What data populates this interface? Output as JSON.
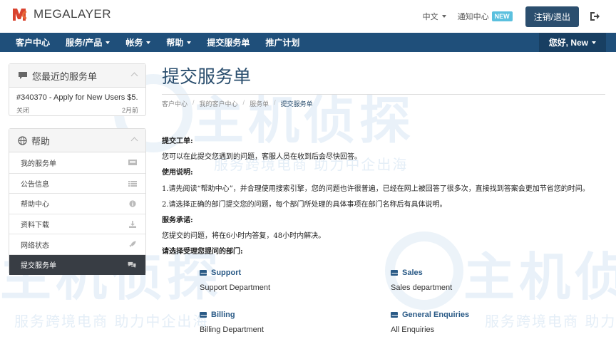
{
  "brand": {
    "logo_text": "MEGALAYER"
  },
  "top": {
    "language": "中文",
    "notifications": "通知中心",
    "new_badge": "NEW",
    "logout": "注销/退出"
  },
  "nav": {
    "items": [
      {
        "label": "客户中心",
        "dropdown": false
      },
      {
        "label": "服务/产品",
        "dropdown": true
      },
      {
        "label": "帐务",
        "dropdown": true
      },
      {
        "label": "帮助",
        "dropdown": true
      },
      {
        "label": "提交服务单",
        "dropdown": false
      },
      {
        "label": "推广计划",
        "dropdown": false
      }
    ],
    "user": "您好, New"
  },
  "recent_panel": {
    "title": "您最近的服务单",
    "ticket": {
      "title": "#340370 - Apply for New Users $5...",
      "status": "关闭",
      "age": "2月前"
    }
  },
  "help_panel": {
    "title": "帮助",
    "items": [
      {
        "label": "我的服务单",
        "icon": "ticket-icon"
      },
      {
        "label": "公告信息",
        "icon": "list-icon"
      },
      {
        "label": "帮助中心",
        "icon": "info-icon"
      },
      {
        "label": "资料下载",
        "icon": "download-icon"
      },
      {
        "label": "网络状态",
        "icon": "rocket-icon"
      },
      {
        "label": "提交服务单",
        "icon": "comments-icon"
      }
    ]
  },
  "page": {
    "title": "提交服务单",
    "breadcrumb": [
      "客户中心",
      "我的客户中心",
      "服务单",
      "提交服务单"
    ]
  },
  "content": {
    "l1": "提交工单:",
    "l2": "您可以在此提交您遇到的问题，客服人员在收到后会尽快回答。",
    "l3": "使用说明:",
    "l4": "1.请先阅读“帮助中心”，并合理使用搜索引擎，您的问题也许很普遍，已经在网上被回答了很多次，直接找到答案会更加节省您的时间。",
    "l5": "2.请选择正确的部门提交您的问题，每个部门所处理的具体事项在部门名称后有具体说明。",
    "l6": "服务承诺:",
    "l7": "您提交的问题，将在6小时内答复，48小时内解决。",
    "l8": "请选择受理您提问的部门:"
  },
  "departments": [
    {
      "name": "Support",
      "desc": "Support Department"
    },
    {
      "name": "Sales",
      "desc": "Sales department"
    },
    {
      "name": "Billing",
      "desc": "Billing Department"
    },
    {
      "name": "General Enquiries",
      "desc": "All Enquiries"
    }
  ],
  "watermark": {
    "big": "主机侦探",
    "small": "服务跨境电商 助力中企出海"
  },
  "colors": {
    "nav": "#1f4f7a",
    "accent": "#2a5a86",
    "badge": "#5bc0de",
    "logo": "#d9432f"
  }
}
